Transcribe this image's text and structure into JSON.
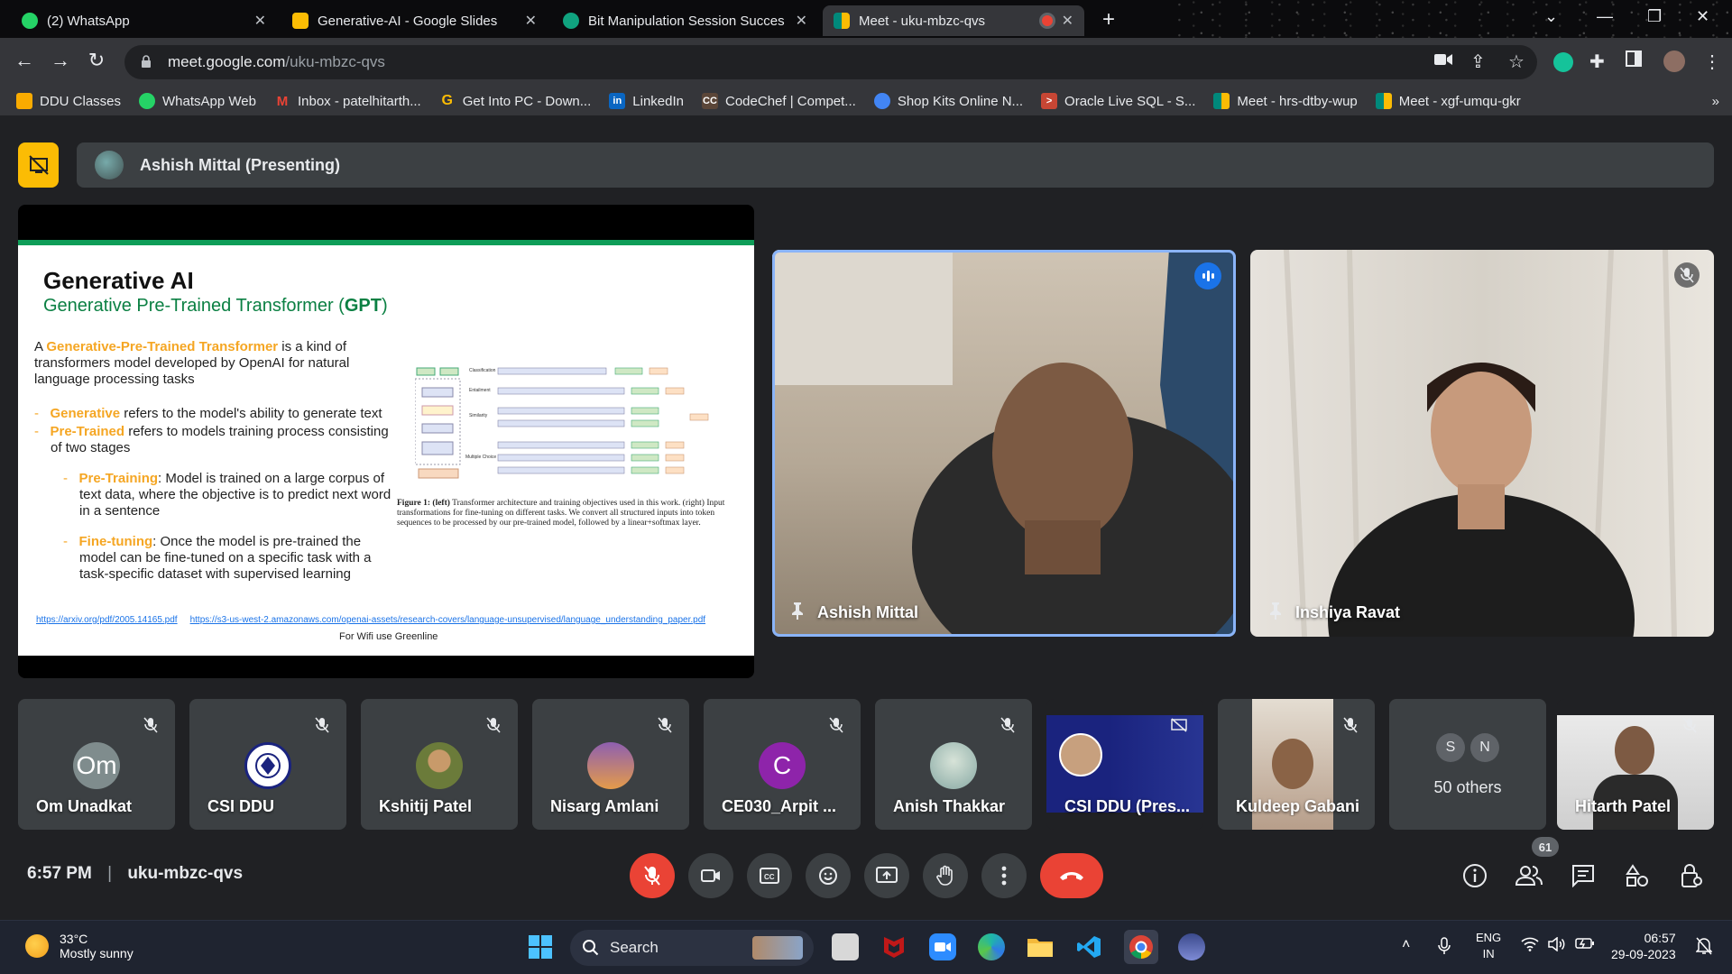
{
  "browser": {
    "tabs": [
      {
        "title": "(2) WhatsApp",
        "icon": "whatsapp-icon",
        "color": "#25d366"
      },
      {
        "title": "Generative-AI - Google Slides",
        "icon": "google-slides-icon",
        "color": "#fbbc04"
      },
      {
        "title": "Bit Manipulation Session Succes",
        "icon": "chatgpt-icon",
        "color": "#10a37f"
      },
      {
        "title": "Meet - uku-mbzc-qvs",
        "icon": "google-meet-icon",
        "color": "#00897b"
      }
    ],
    "url_host": "meet.google.com",
    "url_path": "/uku-mbzc-qvs",
    "bookmarks": [
      {
        "label": "DDU Classes",
        "color": "#f9ab00"
      },
      {
        "label": "WhatsApp Web",
        "color": "#25d366"
      },
      {
        "label": "Inbox - patelhitarth...",
        "color": "#ea4335"
      },
      {
        "label": "Get Into PC - Down...",
        "color": "#fbbc04"
      },
      {
        "label": "LinkedIn",
        "color": "#0a66c2"
      },
      {
        "label": "CodeChef | Compet...",
        "color": "#5b4638"
      },
      {
        "label": "Shop Kits Online N...",
        "color": "#4285f4"
      },
      {
        "label": "Oracle Live SQL - S...",
        "color": "#c74634"
      },
      {
        "label": "Meet - hrs-dtby-wup",
        "color": "#00897b"
      },
      {
        "label": "Meet - xgf-umqu-gkr",
        "color": "#00897b"
      }
    ]
  },
  "meet": {
    "presenter_label": "Ashish Mittal (Presenting)",
    "slide": {
      "title": "Generative AI",
      "subtitle_plain": "Generative Pre-Trained Transformer (",
      "subtitle_bold": "GPT",
      "subtitle_end": ")",
      "intro_a": "A ",
      "intro_highlight": "Generative-Pre-Trained Transformer",
      "intro_rest": " is a kind of transformers model developed by OpenAI for natural language processing tasks",
      "b1_highlight": "Generative",
      "b1_rest": " refers to the model's ability to generate text",
      "b2_highlight": "Pre-Trained",
      "b2_rest": " refers to models training process consisting of two stages",
      "s1_highlight": "Pre-Training",
      "s1_rest": ": Model is trained on a large corpus of text data, where the objective is to predict next word in a sentence",
      "s2_highlight": "Fine-tuning",
      "s2_rest": ": Once the model is pre-trained the model can be fine-tuned on a specific task with a task-specific dataset with supervised learning",
      "caption_bold": "Figure 1: (left)",
      "caption": " Transformer architecture and training objectives used in this work. (right) Input transformations for fine-tuning on different tasks. We convert all structured inputs into token sequences to be processed by our pre-trained model, followed by a linear+softmax layer.",
      "link1": "https://arxiv.org/pdf/2005.14165.pdf",
      "link2": "https://s3-us-west-2.amazonaws.com/openai-assets/research-covers/language-unsupervised/language_understanding_paper.pdf",
      "wifi_note": "For Wifi use Greenline",
      "fig_rows": [
        "Classification",
        "Entailment",
        "Similarity",
        "Multiple Choice"
      ]
    },
    "main_tiles": [
      {
        "name": "Ashish Mittal"
      },
      {
        "name": "Inshiya Ravat"
      }
    ],
    "participants": [
      {
        "name": "Om Unadkat",
        "initials": "Om",
        "color": "#7f8c8d"
      },
      {
        "name": "CSI DDU",
        "initials": "",
        "color": "#ffffff"
      },
      {
        "name": "Kshitij Patel",
        "initials": "",
        "color": "#8a9a5b"
      },
      {
        "name": "Nisarg Amlani",
        "initials": "",
        "color": "#6a4c93"
      },
      {
        "name": "CE030_Arpit ...",
        "initials": "C",
        "color": "#8e24aa"
      },
      {
        "name": "Anish Thakkar",
        "initials": "",
        "color": "#9fb6b0"
      },
      {
        "name": "CSI DDU (Pres...",
        "initials": "",
        "color": "#1a237e"
      },
      {
        "name": "Kuldeep Gabani",
        "initials": "",
        "color": "#a08c7a"
      },
      {
        "name": "50 others",
        "initials": "",
        "color": "#3c4043"
      },
      {
        "name": "Hitarth Patel",
        "initials": "",
        "color": "#dcdcdc"
      }
    ],
    "others_initials": [
      "S",
      "N"
    ],
    "time": "6:57 PM",
    "meeting_code": "uku-mbzc-qvs",
    "people_count": "61"
  },
  "taskbar": {
    "temp": "33°C",
    "weather": "Mostly sunny",
    "search_placeholder": "Search",
    "lang1": "ENG",
    "lang2": "IN",
    "time": "06:57",
    "date": "29-09-2023"
  }
}
